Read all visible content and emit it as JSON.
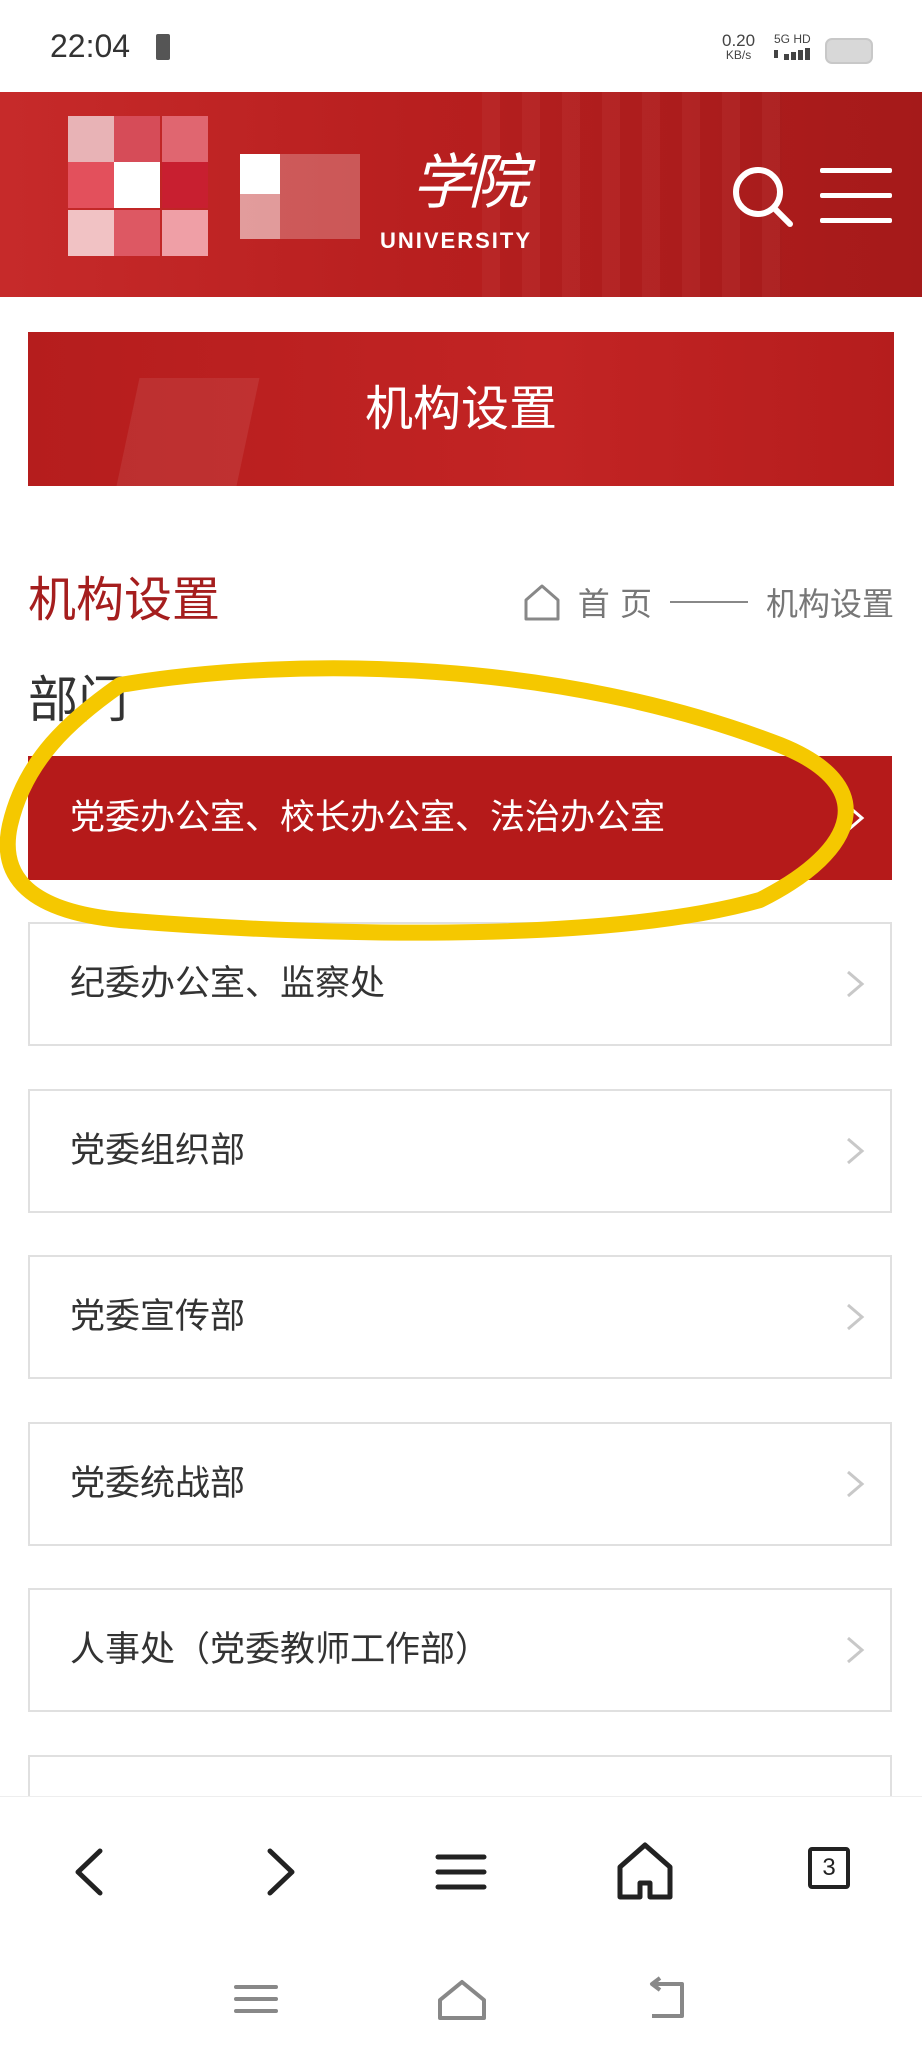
{
  "status_bar": {
    "time": "22:04",
    "net_speed_value": "0.20",
    "net_speed_unit": "KB/s",
    "signal": "5G HD",
    "battery_icon": "battery-icon"
  },
  "header": {
    "logo_calligraphy": "学院",
    "logo_english": "UNIVERSITY",
    "search_icon": "search-icon",
    "menu_icon": "hamburger-menu-icon"
  },
  "banner": {
    "title": "机构设置"
  },
  "section": {
    "title": "机构设置",
    "breadcrumb": {
      "home": "首 页",
      "current": "机构设置"
    },
    "group_label": "部门"
  },
  "departments": [
    {
      "label": "党委办公室、校长办公室、法治办公室",
      "active": true
    },
    {
      "label": "纪委办公室、监察处",
      "active": false
    },
    {
      "label": "党委组织部",
      "active": false
    },
    {
      "label": "党委宣传部",
      "active": false
    },
    {
      "label": "党委统战部",
      "active": false
    },
    {
      "label": "人事处（党委教师工作部）",
      "active": false
    }
  ],
  "browser_toolbar": {
    "tab_count": "3"
  },
  "colors": {
    "brand_red": "#b51a1a",
    "highlight_yellow": "#f5c800"
  }
}
